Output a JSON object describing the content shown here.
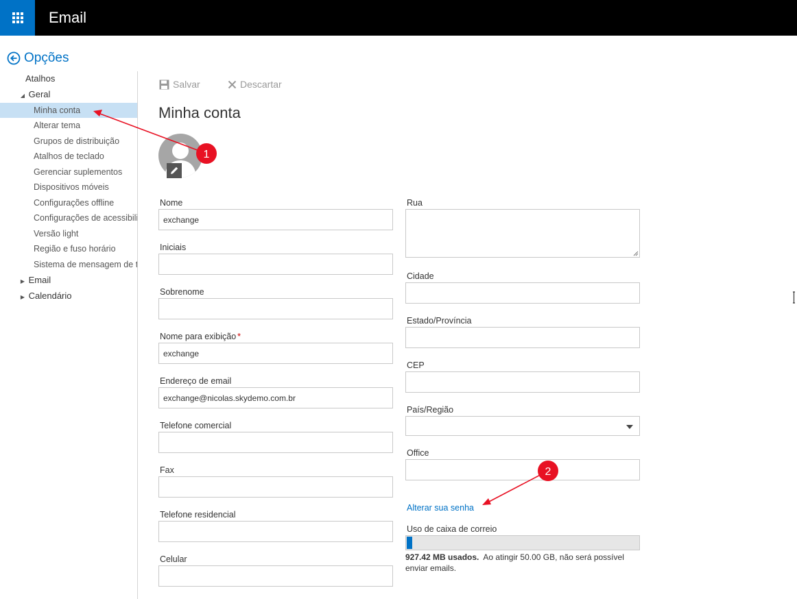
{
  "header": {
    "app_title": "Email",
    "waffle_icon": "app-launcher-icon",
    "bar_color": "#000000",
    "accent": "#0072c6"
  },
  "options": {
    "back_label": "Opções"
  },
  "sidebar": {
    "shortcuts": "Atalhos",
    "general": "Geral",
    "general_items": [
      "Minha conta",
      "Alterar tema",
      "Grupos de distribuição",
      "Atalhos de teclado",
      "Gerenciar suplementos",
      "Dispositivos móveis",
      "Configurações offline",
      "Configurações de acessibilidade",
      "Versão light",
      "Região e fuso horário",
      "Sistema de mensagem de texto"
    ],
    "selected_item": "Minha conta",
    "email": "Email",
    "calendar": "Calendário"
  },
  "toolbar": {
    "save_label": "Salvar",
    "discard_label": "Descartar"
  },
  "page": {
    "title": "Minha conta"
  },
  "form": {
    "name_label": "Nome",
    "name_value": "exchange",
    "initials_label": "Iniciais",
    "initials_value": "",
    "surname_label": "Sobrenome",
    "surname_value": "",
    "display_name_label": "Nome para exibição",
    "display_name_required": "*",
    "display_name_value": "exchange",
    "email_label": "Endereço de email",
    "email_value": "exchange@nicolas.skydemo.com.br",
    "work_phone_label": "Telefone comercial",
    "work_phone_value": "",
    "fax_label": "Fax",
    "fax_value": "",
    "home_phone_label": "Telefone residencial",
    "home_phone_value": "",
    "mobile_label": "Celular",
    "mobile_value": "",
    "street_label": "Rua",
    "street_value": "",
    "city_label": "Cidade",
    "city_value": "",
    "state_label": "Estado/Província",
    "state_value": "",
    "zip_label": "CEP",
    "zip_value": "",
    "country_label": "País/Região",
    "country_value": "",
    "office_label": "Office",
    "office_value": ""
  },
  "password": {
    "change_link": "Alterar sua senha"
  },
  "mailbox": {
    "usage_label": "Uso de caixa de correio",
    "used_fraction": 0.018,
    "used_text": "927.42 MB usados.",
    "limit_text": "Ao atingir 50.00 GB, não será possível enviar emails."
  },
  "annotations": {
    "marker_1": "1",
    "marker_2": "2",
    "color": "#e81123"
  }
}
